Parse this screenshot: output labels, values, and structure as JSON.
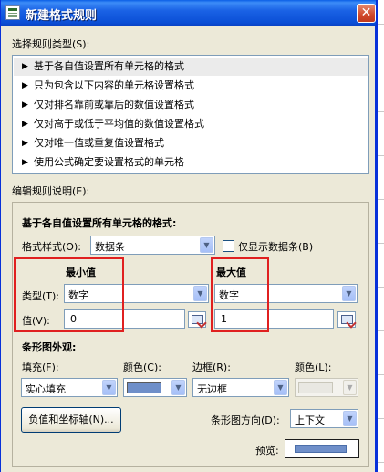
{
  "window": {
    "title": "新建格式规则",
    "close_glyph": "✕"
  },
  "select_rule_type": {
    "label": "选择规则类型(S):",
    "items": [
      "基于各自值设置所有单元格的格式",
      "只为包含以下内容的单元格设置格式",
      "仅对排名靠前或靠后的数值设置格式",
      "仅对高于或低于平均值的数值设置格式",
      "仅对唯一值或重复值设置格式",
      "使用公式确定要设置格式的单元格"
    ],
    "selected_index": 0,
    "bullet_glyph": "▶"
  },
  "edit_rule": {
    "label": "编辑规则说明(E):",
    "heading": "基于各自值设置所有单元格的格式:",
    "format_style": {
      "label": "格式样式(O):",
      "value": "数据条"
    },
    "show_bar_only": {
      "label": "仅显示数据条(B)",
      "checked": false
    },
    "min": {
      "header": "最小值",
      "type_label": "类型(T):",
      "type_value": "数字",
      "value_label": "值(V):",
      "value": "0"
    },
    "max": {
      "header": "最大值",
      "type_value": "数字",
      "value": "1"
    },
    "bar_appearance": {
      "label": "条形图外观:",
      "fill_label": "填充(F):",
      "fill_value": "实心填充",
      "color_label": "颜色(C):",
      "color_value": "#6f8fc9",
      "border_label": "边框(R):",
      "border_value": "无边框",
      "border_color_label": "颜色(L):"
    },
    "negative_axis_button": "负值和坐标轴(N)...",
    "direction": {
      "label": "条形图方向(D):",
      "value": "上下文"
    },
    "preview_label": "预览:"
  },
  "icons": {
    "dropdown": "▼",
    "collapse_dialog": "range-picker-icon"
  },
  "colors": {
    "title_bar": "#0b4fd6",
    "highlight": "#e02020",
    "bar": "#6f8fc9",
    "dialog_bg": "#ece9d8"
  }
}
